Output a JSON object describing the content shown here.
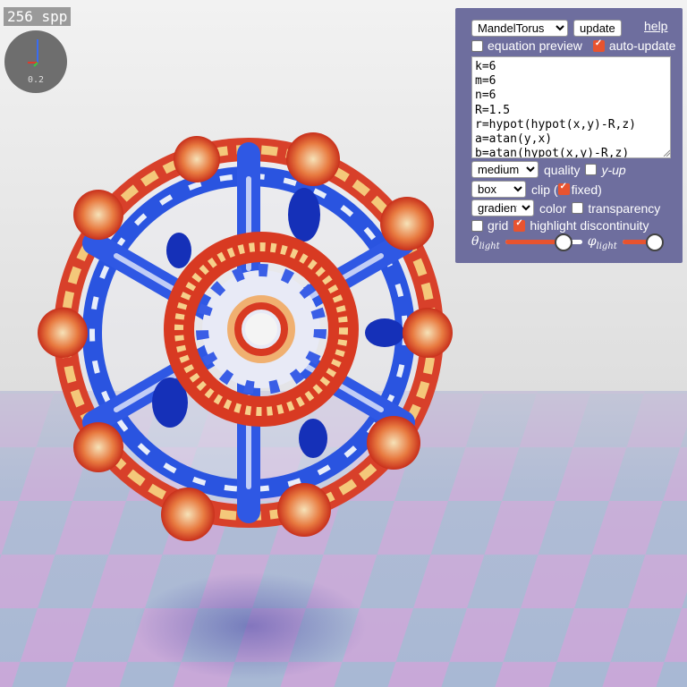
{
  "overlay": {
    "spp_label": "256 spp",
    "gizmo_scale": "0.2"
  },
  "panel": {
    "function_select": {
      "value": "MandelTorus",
      "options": [
        "MandelTorus"
      ]
    },
    "update_label": "update",
    "help_label": "help",
    "equation_preview": {
      "label": "equation preview",
      "checked": false
    },
    "auto_update": {
      "label": "auto-update",
      "checked": true
    },
    "equation_text": "k=6\nm=6\nn=6\nR=1.5\nr=hypot(hypot(x,y)-R,z)\na=atan(y,x)\nb=atan(hypot(x,y)-R,z)",
    "quality": {
      "value": "medium",
      "label": "quality"
    },
    "y_up": {
      "label": "y-up",
      "checked": false
    },
    "clip": {
      "value": "box",
      "label": "clip (",
      "fixed_label": "fixed)",
      "fixed_checked": true
    },
    "color": {
      "value": "gradient",
      "label": "color"
    },
    "transparency": {
      "label": "transparency",
      "checked": false
    },
    "grid": {
      "label": "grid",
      "checked": false
    },
    "highlight_discontinuity": {
      "label": "highlight discontinuity",
      "checked": true
    },
    "theta_light": {
      "symbol": "θ",
      "subscript": "light",
      "value": 0.75
    },
    "phi_light": {
      "symbol": "φ",
      "subscript": "light",
      "value": 0.85
    }
  },
  "colors": {
    "accent": "#e8532f",
    "panel_bg": "#6e6e9e",
    "floor_a": "#a8b8d4",
    "floor_b": "#c8a8d8",
    "gradient_high": "#d83a22",
    "gradient_mid": "#f4d6a0",
    "gradient_low": "#2648d8"
  }
}
